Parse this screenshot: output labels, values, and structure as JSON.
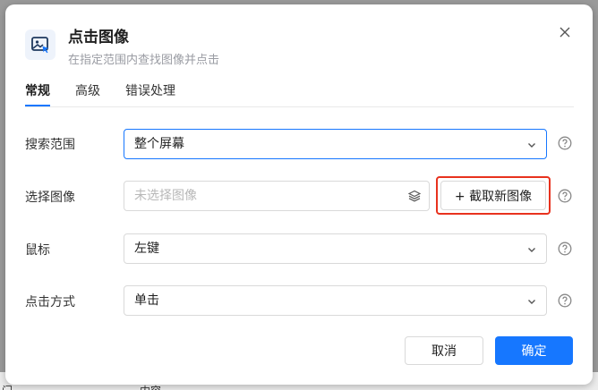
{
  "dialog": {
    "title": "点击图像",
    "subtitle": "在指定范围内查找图像并点击",
    "app_icon": "image-cursor-icon",
    "close_icon": "close-icon"
  },
  "tabs": [
    {
      "label": "常规",
      "active": true
    },
    {
      "label": "高级",
      "active": false
    },
    {
      "label": "错误处理",
      "active": false
    }
  ],
  "form": {
    "search_range": {
      "label": "搜索范围",
      "value": "整个屏幕"
    },
    "select_image": {
      "label": "选择图像",
      "placeholder": "未选择图像",
      "capture_button": "+ 截取新图像",
      "layers_icon": "layers-icon"
    },
    "mouse": {
      "label": "鼠标",
      "value": "左键"
    },
    "click_method": {
      "label": "点击方式",
      "value": "单击"
    }
  },
  "footer": {
    "cancel_label": "取消",
    "confirm_label": "确定"
  },
  "backdrop": {
    "text_left": "门",
    "text_mid": "内容"
  },
  "colors": {
    "primary": "#1677ff",
    "highlight": "#e8321e",
    "border": "#d9d9d9"
  }
}
